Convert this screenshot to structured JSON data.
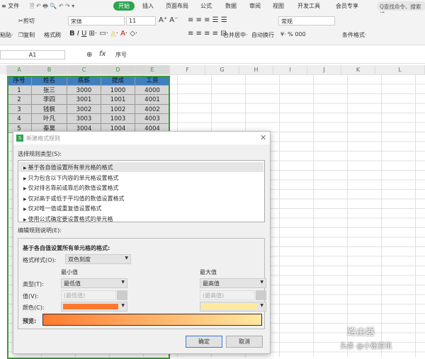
{
  "menubar": {
    "file": "≡ 文件",
    "tabs": [
      "开始",
      "插入",
      "页面布局",
      "公式",
      "数据",
      "审阅",
      "视图",
      "开发工具",
      "会员专享"
    ],
    "search": "Q查找命令、搜索模"
  },
  "ribbon": {
    "paste": "粘贴·",
    "cut": "剪切",
    "copy": "复制",
    "format_painter": "格式刷",
    "font": "宋体",
    "font_size": "11",
    "merge": "合并居中·",
    "wrap": "自动换行",
    "number_format": "常规",
    "currency": "¥·  %  000",
    "cond_format": "条件格式·"
  },
  "formula_bar": {
    "cell_ref": "A1",
    "fx": "fx",
    "value": "序号"
  },
  "sheet": {
    "columns": [
      "A",
      "B",
      "C",
      "D",
      "E",
      "F",
      "G",
      "H",
      "I",
      "J",
      "K",
      "L"
    ],
    "header": [
      "序号",
      "姓名",
      "底薪",
      "提成",
      "工资"
    ],
    "rows": [
      [
        "1",
        "张三",
        "3000",
        "1000",
        "4000"
      ],
      [
        "2",
        "李四",
        "3001",
        "1001",
        "4001"
      ],
      [
        "3",
        "钱枫",
        "3002",
        "1002",
        "4002"
      ],
      [
        "4",
        "叶凡",
        "3003",
        "1003",
        "4003"
      ],
      [
        "5",
        "秦昊",
        "3004",
        "1004",
        "4004"
      ]
    ]
  },
  "dialog": {
    "title": "新建格式规则",
    "rule_type_label": "选择规则类型(S):",
    "rule_types": [
      "基于各自值设置所有单元格的格式",
      "只为包含以下内容的单元格设置格式",
      "仅对排名靠前或靠后的数值设置格式",
      "仅对高于或低于平均值的数值设置格式",
      "仅对唯一值或重复值设置格式",
      "使用公式确定要设置格式的单元格"
    ],
    "edit_label": "编辑规则说明(E):",
    "section_title": "基于各自值设置所有单元格的格式:",
    "style_label": "格式样式(O):",
    "style_value": "双色刻度",
    "min_label": "最小值",
    "max_label": "最大值",
    "type_label": "类型(T):",
    "min_type": "最低值",
    "max_type": "最高值",
    "value_label": "值(V):",
    "min_value_placeholder": "(最低值)",
    "max_value_placeholder": "(最高值)",
    "color_label": "颜色(C):",
    "min_color": "#ff7a30",
    "max_color": "#ffe9a0",
    "preview_label": "预览:",
    "ok": "确定",
    "cancel": "取消"
  },
  "watermark": {
    "logo": "路由器",
    "text": "头条 @小张资讯"
  }
}
